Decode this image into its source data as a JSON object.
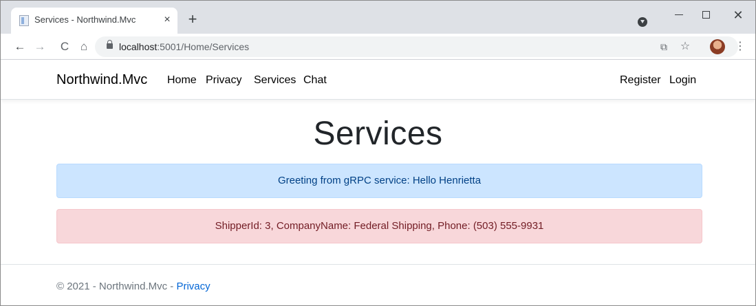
{
  "browser": {
    "tab": {
      "title": "Services - Northwind.Mvc",
      "close": "×"
    },
    "new_tab": "+",
    "window": {
      "close": "✕"
    },
    "toolbar": {
      "back": "←",
      "forward": "→",
      "reload": "C",
      "home": "⌂",
      "url_host": "localhost",
      "url_path": ":5001/Home/Services",
      "share": "⧉",
      "star": "☆",
      "menu": "⋮"
    }
  },
  "navbar": {
    "brand": "Northwind.Mvc",
    "links": [
      "Home",
      "Privacy",
      "Services",
      "Chat"
    ],
    "right_links": [
      "Register",
      "Login"
    ]
  },
  "main": {
    "heading": "Services",
    "greeting_alert": "Greeting from gRPC service: Hello Henrietta",
    "shipper_alert": "ShipperId: 3, CompanyName: Federal Shipping, Phone: (503) 555-9931"
  },
  "footer": {
    "text": "© 2021 - Northwind.Mvc - ",
    "privacy_link": "Privacy"
  },
  "colors": {
    "info_bg": "#cce5ff",
    "info_text": "#004085",
    "danger_bg": "#f8d7da",
    "danger_text": "#721c24",
    "link": "#0366d6"
  }
}
